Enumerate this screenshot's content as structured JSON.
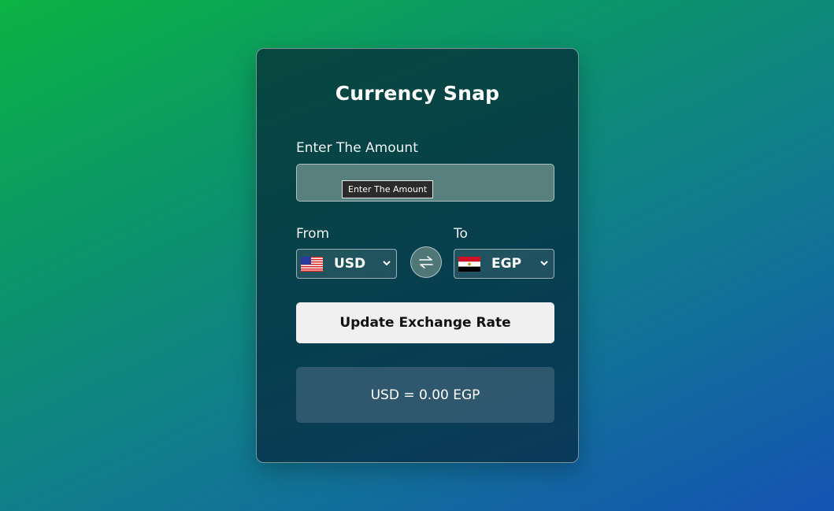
{
  "app": {
    "title": "Currency Snap"
  },
  "amount": {
    "label": "Enter The Amount",
    "value": "",
    "tooltip": "Enter The Amount"
  },
  "from": {
    "label": "From",
    "currency": "USD",
    "flag": "us-flag"
  },
  "to": {
    "label": "To",
    "currency": "EGP",
    "flag": "egypt-flag"
  },
  "swap": {
    "icon": "swap-arrows-icon"
  },
  "button": {
    "label": "Update Exchange Rate"
  },
  "result": {
    "text": "USD = 0.00 EGP"
  }
}
